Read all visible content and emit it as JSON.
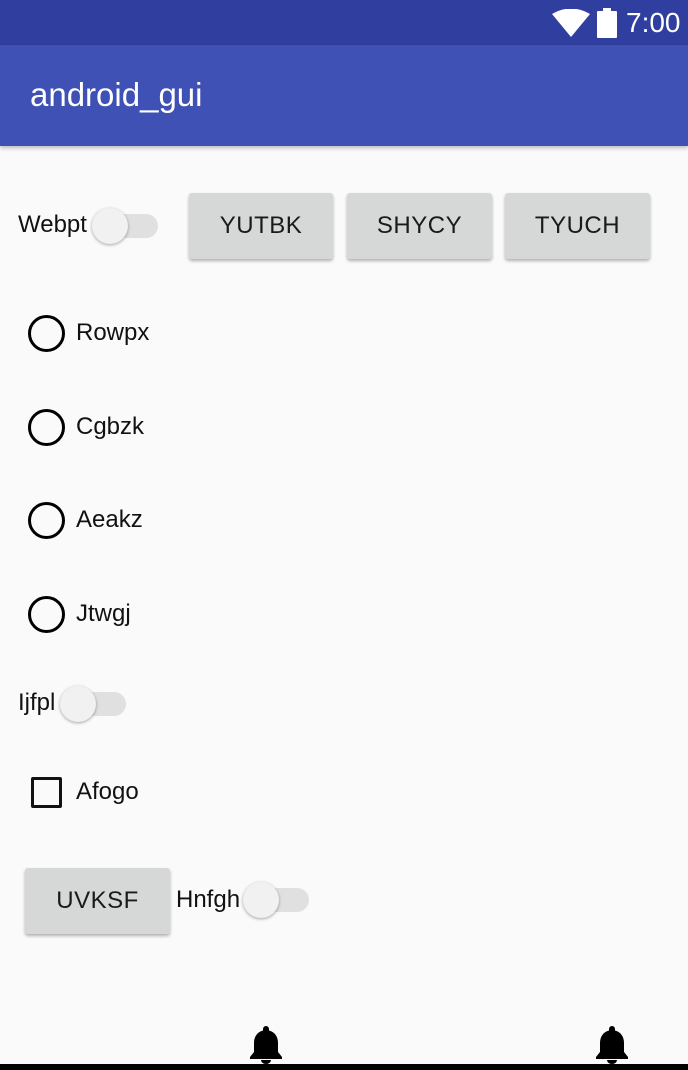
{
  "status_bar": {
    "time": "7:00",
    "wifi_icon": "wifi-icon",
    "battery_icon": "battery-icon",
    "color": "#303f9f"
  },
  "app_bar": {
    "title": "android_gui",
    "color": "#3f51b5"
  },
  "row1": {
    "switch_label": "Webpt",
    "buttons": [
      "YUTBK",
      "SHYCY",
      "TYUCH"
    ]
  },
  "radios": [
    "Rowpx",
    "Cgbzk",
    "Aeakz",
    "Jtwgj"
  ],
  "switch2_label": "Ijfpl",
  "checkbox_label": "Afogo",
  "bottom_row": {
    "button_label": "UVKSF",
    "switch_label": "Hnfgh"
  },
  "bottom_bar": {
    "icons": [
      "bell-icon",
      "bell-icon"
    ]
  }
}
